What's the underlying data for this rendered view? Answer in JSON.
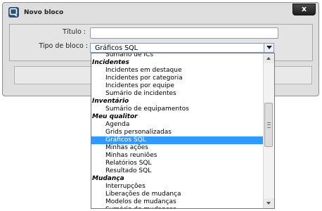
{
  "dialog": {
    "title": "Novo bloco",
    "close_label": "x"
  },
  "form": {
    "titulo_label": "Título :",
    "titulo_value": "",
    "tipo_label": "Tipo de bloco :",
    "tipo_value": "Gráficos SQL"
  },
  "dropdown": {
    "items": [
      {
        "label": "Sumário de ICs",
        "group": false,
        "selected": false
      },
      {
        "label": "Incidentes",
        "group": true,
        "selected": false
      },
      {
        "label": "Incidentes em destaque",
        "group": false,
        "selected": false
      },
      {
        "label": "Incidentes por categoria",
        "group": false,
        "selected": false
      },
      {
        "label": "Incidentes por equipe",
        "group": false,
        "selected": false
      },
      {
        "label": "Sumário de incidentes",
        "group": false,
        "selected": false
      },
      {
        "label": "Inventário",
        "group": true,
        "selected": false
      },
      {
        "label": "Sumário de equipamentos",
        "group": false,
        "selected": false
      },
      {
        "label": "Meu qualitor",
        "group": true,
        "selected": false
      },
      {
        "label": "Agenda",
        "group": false,
        "selected": false
      },
      {
        "label": "Grids personalizadas",
        "group": false,
        "selected": false
      },
      {
        "label": "Gráficos SQL",
        "group": false,
        "selected": true
      },
      {
        "label": "Minhas ações",
        "group": false,
        "selected": false
      },
      {
        "label": "Minhas reuniões",
        "group": false,
        "selected": false
      },
      {
        "label": "Relatórios SQL",
        "group": false,
        "selected": false
      },
      {
        "label": "Resultado SQL",
        "group": false,
        "selected": false
      },
      {
        "label": "Mudança",
        "group": true,
        "selected": false
      },
      {
        "label": "Interrupções",
        "group": false,
        "selected": false
      },
      {
        "label": "Liberações de mudança",
        "group": false,
        "selected": false
      },
      {
        "label": "Modelos de mudanças",
        "group": false,
        "selected": false
      },
      {
        "label": "Sumário de mudanças",
        "group": false,
        "selected": false
      }
    ]
  },
  "icons": {
    "app": "window-app-icon",
    "close": "close-icon",
    "dropdown_arrow": "chevron-down-icon"
  }
}
